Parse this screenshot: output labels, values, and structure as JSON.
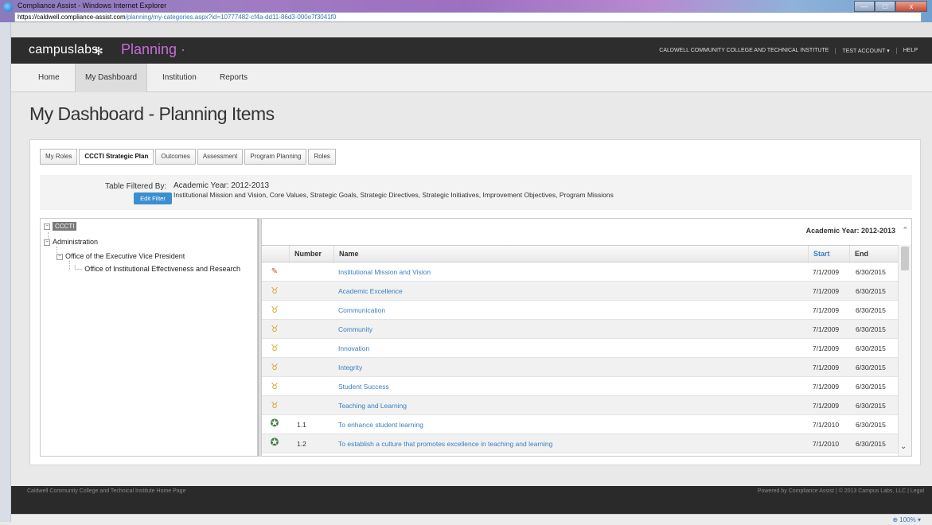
{
  "browser": {
    "title": "Compliance Assist - Windows Internet Explorer",
    "address_host": "https://caldwell.compliance-assist.com",
    "address_path": "/planning/my-categories.aspx?id=10777482-cf4a-dd11-86d3-000e7f3041f0",
    "zoom": "100%",
    "win_min": "—",
    "win_max": "□",
    "win_close": "x"
  },
  "header": {
    "brand": "campuslabs",
    "product": "Planning ·",
    "institution": "CALDWELL COMMUNITY COLLEGE AND TECHNICAL INSTITUTE",
    "account": "TEST ACCOUNT ▾",
    "help": "HELP"
  },
  "nav": {
    "items": [
      "Home",
      "My Dashboard",
      "Institution",
      "Reports"
    ]
  },
  "page": {
    "title": "My Dashboard - Planning Items"
  },
  "subtabs": [
    "My Roles",
    "CCCTI Strategic Plan",
    "Outcomes",
    "Assessment",
    "Program Planning",
    "Roles"
  ],
  "filter": {
    "label": "Table Filtered By:",
    "year": "Academic Year: 2012-2013",
    "categories": "Institutional Mission and Vision, Core Values, Strategic Goals, Strategic Directives, Strategic Initiatives, Improvement Objectives, Program Missions",
    "edit_button": "Edit Filter"
  },
  "tree": {
    "root": "CCCTI",
    "level1": "Administration",
    "level2": "Office of the Executive Vice President",
    "level3": "Office of Institutional Effectiveness and Research"
  },
  "grid": {
    "caption": "Academic Year: 2012-2013",
    "columns": {
      "number": "Number",
      "name": "Name",
      "start": "Start",
      "end": "End"
    },
    "rows": [
      {
        "icon": "pen-icon",
        "number": "",
        "name": "Institutional Mission and Vision",
        "start": "7/1/2009",
        "end": "6/30/2015"
      },
      {
        "icon": "medal-icon",
        "number": "",
        "name": "Academic Excellence",
        "start": "7/1/2009",
        "end": "6/30/2015"
      },
      {
        "icon": "medal-icon",
        "number": "",
        "name": "Communication",
        "start": "7/1/2009",
        "end": "6/30/2015"
      },
      {
        "icon": "medal-icon",
        "number": "",
        "name": "Community",
        "start": "7/1/2009",
        "end": "6/30/2015"
      },
      {
        "icon": "medal-icon",
        "number": "",
        "name": "Innovation",
        "start": "7/1/2009",
        "end": "6/30/2015"
      },
      {
        "icon": "medal-icon",
        "number": "",
        "name": "Integrity",
        "start": "7/1/2009",
        "end": "6/30/2015"
      },
      {
        "icon": "medal-icon",
        "number": "",
        "name": "Student Success",
        "start": "7/1/2009",
        "end": "6/30/2015"
      },
      {
        "icon": "medal-icon",
        "number": "",
        "name": "Teaching and Learning",
        "start": "7/1/2009",
        "end": "6/30/2015"
      },
      {
        "icon": "gear-icon",
        "number": "1.1",
        "name": "To enhance student learning",
        "start": "7/1/2010",
        "end": "6/30/2015"
      },
      {
        "icon": "gear-icon",
        "number": "1.2",
        "name": "To establish a culture that promotes excellence in teaching and learning",
        "start": "7/1/2010",
        "end": "6/30/2015"
      }
    ]
  },
  "footer": {
    "left": "Caldwell Community College and Technical Institute Home Page",
    "right": "Powered by Compliance Assist | © 2013 Campus Labs, LLC | Legal"
  }
}
